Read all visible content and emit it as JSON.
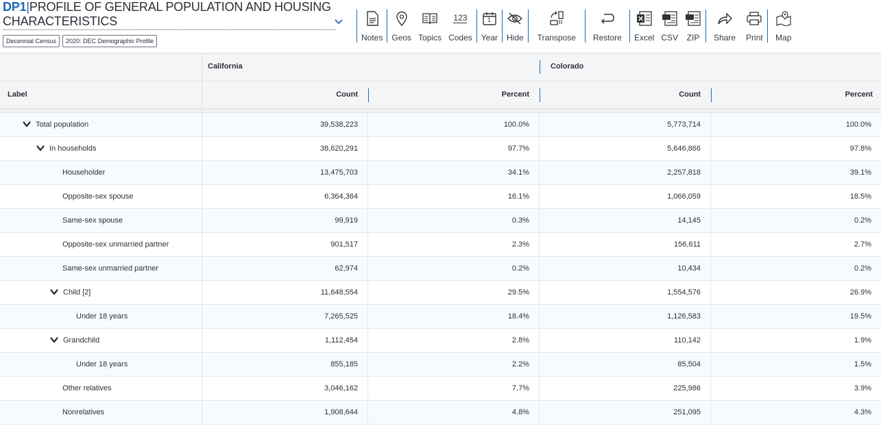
{
  "title": {
    "code": "DP1",
    "text": "PROFILE OF GENERAL POPULATION AND HOUSING CHARACTERISTICS"
  },
  "chips": [
    "Decennial Census",
    "2020: DEC Demographic Profile"
  ],
  "toolbar": {
    "notes": "Notes",
    "geos": "Geos",
    "topics": "Topics",
    "codes": "Codes",
    "codes_icon_text": "123",
    "year": "Year",
    "year_icon_text": "1",
    "hide": "Hide",
    "transpose": "Transpose",
    "restore": "Restore",
    "excel": "Excel",
    "csv": "CSV",
    "zip": "ZIP",
    "share": "Share",
    "print": "Print",
    "map": "Map"
  },
  "table": {
    "label_header": "Label",
    "geographies": [
      "California",
      "Colorado"
    ],
    "columns": [
      "Count",
      "Percent",
      "Count",
      "Percent"
    ],
    "rows": [
      {
        "label": "Total population",
        "level": "lv0",
        "expandable": true,
        "values": [
          "39,538,223",
          "100.0%",
          "5,773,714",
          "100.0%"
        ]
      },
      {
        "label": "In households",
        "level": "lv1",
        "expandable": true,
        "values": [
          "38,620,291",
          "97.7%",
          "5,646,866",
          "97.8%"
        ]
      },
      {
        "label": "Householder",
        "level": "lv2",
        "expandable": false,
        "values": [
          "13,475,703",
          "34.1%",
          "2,257,818",
          "39.1%"
        ]
      },
      {
        "label": "Opposite-sex spouse",
        "level": "lv2",
        "expandable": false,
        "values": [
          "6,364,364",
          "16.1%",
          "1,066,059",
          "18.5%"
        ]
      },
      {
        "label": "Same-sex spouse",
        "level": "lv2",
        "expandable": false,
        "values": [
          "99,919",
          "0.3%",
          "14,145",
          "0.2%"
        ]
      },
      {
        "label": "Opposite-sex unmarried partner",
        "level": "lv2",
        "expandable": false,
        "values": [
          "901,517",
          "2.3%",
          "156,611",
          "2.7%"
        ]
      },
      {
        "label": "Same-sex unmarried partner",
        "level": "lv2",
        "expandable": false,
        "values": [
          "62,974",
          "0.2%",
          "10,434",
          "0.2%"
        ]
      },
      {
        "label": "Child [2]",
        "level": "lv2c",
        "expandable": true,
        "values": [
          "11,648,554",
          "29.5%",
          "1,554,576",
          "26.9%"
        ]
      },
      {
        "label": "Under 18 years",
        "level": "lv3",
        "expandable": false,
        "values": [
          "7,265,525",
          "18.4%",
          "1,126,583",
          "19.5%"
        ]
      },
      {
        "label": "Grandchild",
        "level": "lv2c",
        "expandable": true,
        "values": [
          "1,112,454",
          "2.8%",
          "110,142",
          "1.9%"
        ]
      },
      {
        "label": "Under 18 years",
        "level": "lv3",
        "expandable": false,
        "values": [
          "855,185",
          "2.2%",
          "85,504",
          "1.5%"
        ]
      },
      {
        "label": "Other relatives",
        "level": "lv2",
        "expandable": false,
        "values": [
          "3,046,162",
          "7.7%",
          "225,986",
          "3.9%"
        ]
      },
      {
        "label": "Nonrelatives",
        "level": "lv2",
        "expandable": false,
        "values": [
          "1,908,644",
          "4.8%",
          "251,095",
          "4.3%"
        ]
      }
    ]
  },
  "colors": {
    "accent": "#1d65b8",
    "text": "#2b2f36",
    "header_bg": "#f4f5f6"
  }
}
